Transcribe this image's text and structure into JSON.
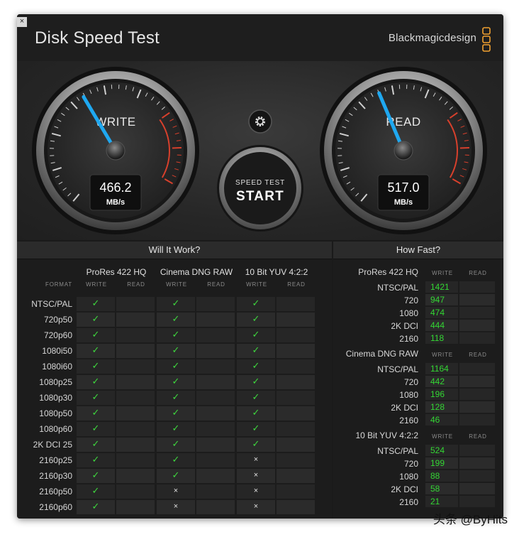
{
  "window": {
    "title": "Disk Speed Test",
    "brand": "Blackmagicdesign",
    "close_label": "×"
  },
  "gauges": {
    "write": {
      "label": "WRITE",
      "value": "466.2",
      "unit": "MB/s",
      "level": 0.42
    },
    "read": {
      "label": "READ",
      "value": "517.0",
      "unit": "MB/s",
      "level": 0.45
    },
    "start": {
      "line1": "SPEED TEST",
      "line2": "START"
    },
    "settings_icon": "gear-icon"
  },
  "will_it_work": {
    "heading": "Will It Work?",
    "format_label": "FORMAT",
    "write_label": "WRITE",
    "read_label": "READ",
    "codecs": [
      "ProRes 422 HQ",
      "Cinema DNG RAW",
      "10 Bit YUV 4:2:2"
    ],
    "rows": [
      {
        "format": "NTSC/PAL",
        "results": [
          "ok",
          "ok",
          "ok"
        ]
      },
      {
        "format": "720p50",
        "results": [
          "ok",
          "ok",
          "ok"
        ]
      },
      {
        "format": "720p60",
        "results": [
          "ok",
          "ok",
          "ok"
        ]
      },
      {
        "format": "1080i50",
        "results": [
          "ok",
          "ok",
          "ok"
        ]
      },
      {
        "format": "1080i60",
        "results": [
          "ok",
          "ok",
          "ok"
        ]
      },
      {
        "format": "1080p25",
        "results": [
          "ok",
          "ok",
          "ok"
        ]
      },
      {
        "format": "1080p30",
        "results": [
          "ok",
          "ok",
          "ok"
        ]
      },
      {
        "format": "1080p50",
        "results": [
          "ok",
          "ok",
          "ok"
        ]
      },
      {
        "format": "1080p60",
        "results": [
          "ok",
          "ok",
          "ok"
        ]
      },
      {
        "format": "2K DCI 25",
        "results": [
          "ok",
          "ok",
          "ok"
        ]
      },
      {
        "format": "2160p25",
        "results": [
          "ok",
          "ok",
          "no"
        ]
      },
      {
        "format": "2160p30",
        "results": [
          "ok",
          "ok",
          "no"
        ]
      },
      {
        "format": "2160p50",
        "results": [
          "ok",
          "no",
          "no"
        ]
      },
      {
        "format": "2160p60",
        "results": [
          "ok",
          "no",
          "no"
        ]
      }
    ],
    "check_glyph": "✓",
    "cross_glyph": "×"
  },
  "how_fast": {
    "heading": "How Fast?",
    "write_label": "WRITE",
    "read_label": "READ",
    "groups": [
      {
        "name": "ProRes 422 HQ",
        "rows": [
          {
            "format": "NTSC/PAL",
            "write": "1421"
          },
          {
            "format": "720",
            "write": "947"
          },
          {
            "format": "1080",
            "write": "474"
          },
          {
            "format": "2K DCI",
            "write": "444"
          },
          {
            "format": "2160",
            "write": "118"
          }
        ]
      },
      {
        "name": "Cinema DNG RAW",
        "rows": [
          {
            "format": "NTSC/PAL",
            "write": "1164"
          },
          {
            "format": "720",
            "write": "442"
          },
          {
            "format": "1080",
            "write": "196"
          },
          {
            "format": "2K DCI",
            "write": "128"
          },
          {
            "format": "2160",
            "write": "46"
          }
        ]
      },
      {
        "name": "10 Bit YUV 4:2:2",
        "rows": [
          {
            "format": "NTSC/PAL",
            "write": "524"
          },
          {
            "format": "720",
            "write": "199"
          },
          {
            "format": "1080",
            "write": "88"
          },
          {
            "format": "2K DCI",
            "write": "58"
          },
          {
            "format": "2160",
            "write": "21"
          }
        ]
      }
    ]
  },
  "watermark": "头条 @ByHits",
  "colors": {
    "needle": "#1fa8f0",
    "ok": "#3ed83e",
    "speed": "#33d633",
    "redzone": "#d8402c",
    "logo": "#f0a030"
  }
}
